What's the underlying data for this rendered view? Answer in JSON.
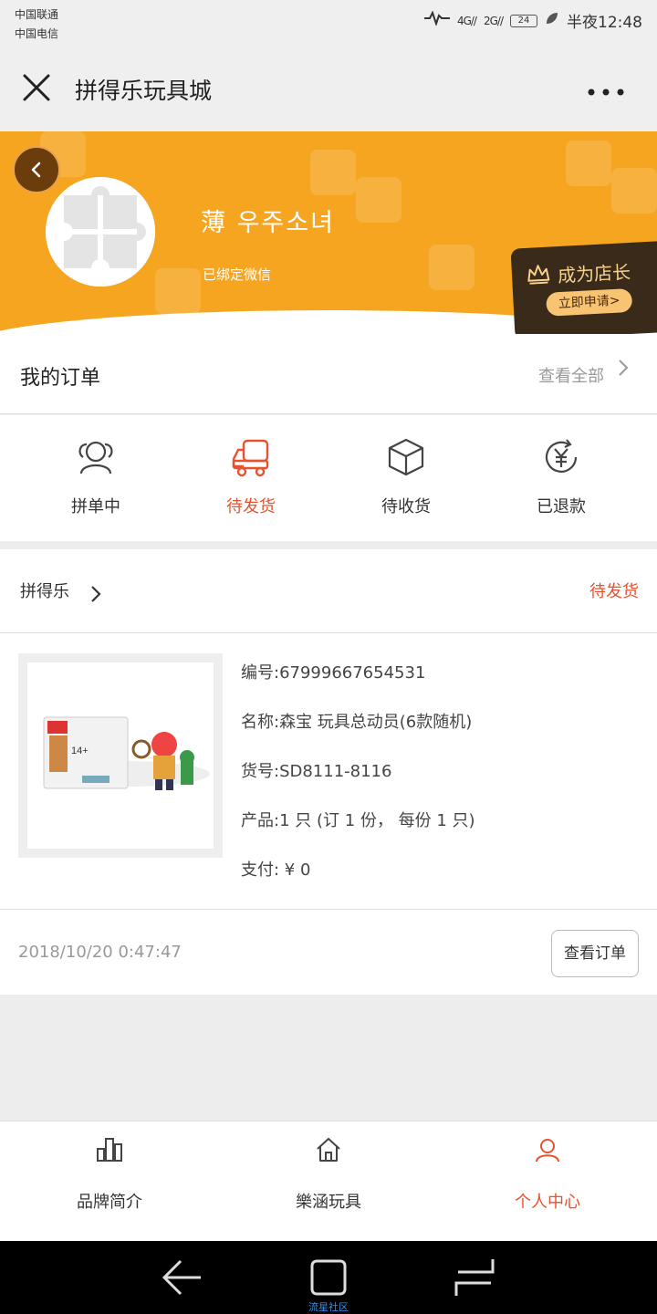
{
  "status_bar": {
    "carrier1": "中国联通",
    "carrier2": "中国电信",
    "signal1": "4G",
    "signal2": "2G",
    "battery": "24",
    "time": "半夜12:48"
  },
  "nav": {
    "title": "拼得乐玩具城",
    "more_icon": "more-dots-icon",
    "close_icon": "close-icon"
  },
  "profile": {
    "username": "薄 우주소녀",
    "bind_status": "已绑定微信",
    "shop_card": {
      "title": "成为店长",
      "apply_label": "立即申请>"
    }
  },
  "orders": {
    "title": "我的订单",
    "view_all": "查看全部",
    "statuses": [
      {
        "label": "拼单中",
        "icon": "group-buy-icon",
        "active": false
      },
      {
        "label": "待发货",
        "icon": "delivery-truck-icon",
        "active": true
      },
      {
        "label": "待收货",
        "icon": "package-box-icon",
        "active": false
      },
      {
        "label": "已退款",
        "icon": "refund-yen-icon",
        "active": false
      }
    ]
  },
  "order_card": {
    "shop_name": "拼得乐",
    "status": "待发货",
    "lines": [
      "编号:67999667654531",
      "名称:森宝 玩具总动员(6款随机)",
      "货号:SD8111-8116",
      "产品:1 只 (订 1 份， 每份 1 只)",
      "支付: ¥ 0"
    ],
    "time": "2018/10/20 0:47:47",
    "view_order": "查看订单",
    "image_text": "14+"
  },
  "tabbar": [
    {
      "label": "品牌简介",
      "icon": "brand-chart-icon",
      "active": false
    },
    {
      "label": "樂涵玩具",
      "icon": "home-icon",
      "active": false
    },
    {
      "label": "个人中心",
      "icon": "user-icon",
      "active": true
    }
  ],
  "system_nav": {
    "caption": "流星社区"
  },
  "colors": {
    "accent": "#e8522f",
    "header": "#f6a520",
    "shop_card": "#3a2a1a"
  }
}
